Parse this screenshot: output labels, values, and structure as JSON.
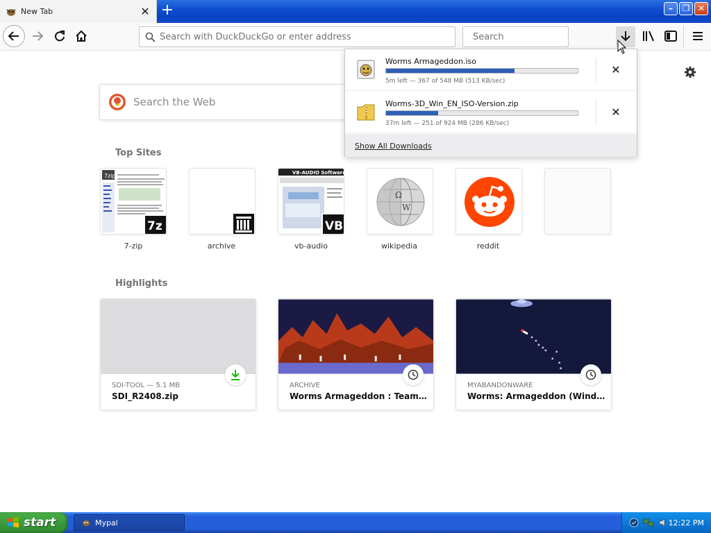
{
  "window": {
    "tab_title": "New Tab",
    "new_tab_label": "+"
  },
  "navbar": {
    "url_placeholder": "Search with DuckDuckGo or enter address",
    "search_placeholder": "Search"
  },
  "main": {
    "web_search_placeholder": "Search the Web",
    "top_sites_heading": "Top Sites",
    "top_sites": [
      {
        "label": "7-zip"
      },
      {
        "label": "archive"
      },
      {
        "label": "vb-audio"
      },
      {
        "label": "wikipedia"
      },
      {
        "label": "reddit"
      },
      {
        "label": ""
      }
    ],
    "highlights_heading": "Highlights",
    "highlights": [
      {
        "source": "SDI-TOOL — 5.1 MB",
        "title": "SDI_R2408.zip",
        "badge": "download-icon"
      },
      {
        "source": "ARCHIVE",
        "title": "Worms Armageddon : Team 17 ...",
        "badge": "clock-icon"
      },
      {
        "source": "MYABANDONWARE",
        "title": "Worms: Armageddon (Window...",
        "badge": "clock-icon"
      }
    ]
  },
  "downloads": {
    "items": [
      {
        "name": "Worms Armageddon.iso",
        "status": "5m left — 367 of 548 MB (513 KB/sec)",
        "progress": 0.67
      },
      {
        "name": "Worms-3D_Win_EN_ISO-Version.zip",
        "status": "37m left — 251 of 924 MB (286 KB/sec)",
        "progress": 0.27
      }
    ],
    "show_all_label": "Show All Downloads"
  },
  "taskbar": {
    "start_label": "start",
    "task_label": "Mypal",
    "clock": "12:22 PM"
  },
  "colors": {
    "progress_fill": "#2f5fb6",
    "reddit": "#ff4500",
    "download_green": "#12bc00"
  }
}
